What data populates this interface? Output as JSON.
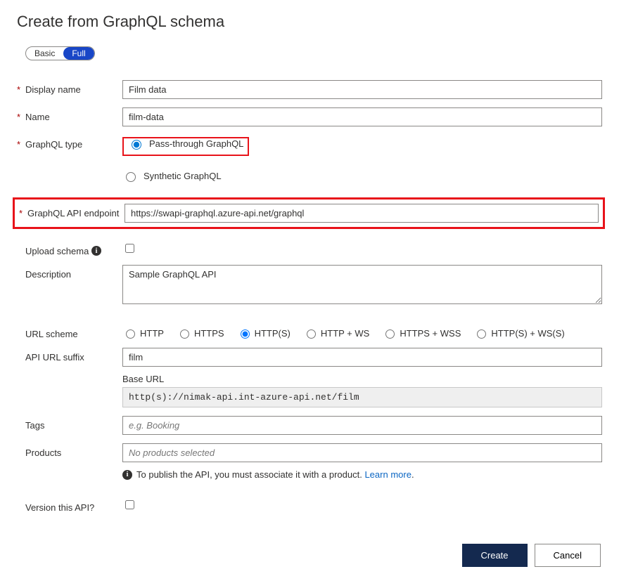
{
  "page": {
    "title": "Create from GraphQL schema"
  },
  "toggle": {
    "basic": "Basic",
    "full": "Full"
  },
  "labels": {
    "display_name": "Display name",
    "name": "Name",
    "graphql_type": "GraphQL type",
    "endpoint": "GraphQL API endpoint",
    "upload_schema": "Upload schema",
    "description": "Description",
    "url_scheme": "URL scheme",
    "api_url_suffix": "API URL suffix",
    "base_url": "Base URL",
    "tags": "Tags",
    "products": "Products",
    "version": "Version this API?"
  },
  "values": {
    "display_name": "Film data",
    "name": "film-data",
    "endpoint": "https://swapi-graphql.azure-api.net/graphql",
    "description": "Sample GraphQL API",
    "api_url_suffix": "film",
    "base_url": "http(s)://nimak-api.int-azure-api.net/film"
  },
  "graphql_type_options": {
    "pass_through": "Pass-through GraphQL",
    "synthetic": "Synthetic GraphQL"
  },
  "url_scheme_options": {
    "http": "HTTP",
    "https": "HTTPS",
    "http_s": "HTTP(S)",
    "http_ws": "HTTP + WS",
    "https_wss": "HTTPS + WSS",
    "http_s_ws_s": "HTTP(S) + WS(S)"
  },
  "placeholders": {
    "tags": "e.g. Booking",
    "products": "No products selected"
  },
  "messages": {
    "publish_note": "To publish the API, you must associate it with a product. ",
    "learn_more": "Learn more"
  },
  "buttons": {
    "create": "Create",
    "cancel": "Cancel"
  }
}
